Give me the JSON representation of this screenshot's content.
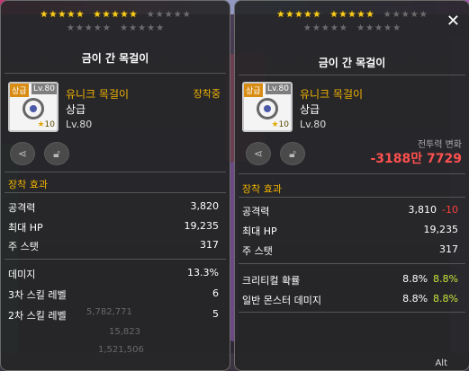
{
  "left": {
    "title": "금이 간 목걸이",
    "rank_tag": "상급",
    "level_tag": "Lv.80",
    "star_tag": "10",
    "item_name": "유니크 목걸이",
    "item_grade": "상급",
    "item_level": "Lv.80",
    "equipped": "장착중",
    "section": "장착 효과",
    "stats": [
      {
        "label": "공격력",
        "value": "3,820"
      },
      {
        "label": "최대 HP",
        "value": "19,235"
      },
      {
        "label": "주 스탯",
        "value": "317"
      },
      {
        "label": "데미지",
        "value": "13.3%"
      },
      {
        "label": "3차 스킬 레벨",
        "value": "6"
      },
      {
        "label": "2차 스킬 레벨",
        "value": "5"
      }
    ],
    "bg_numbers": [
      "5,782,771",
      "15,823",
      "1,521,506"
    ]
  },
  "right": {
    "title": "금이 간 목걸이",
    "rank_tag": "상급",
    "level_tag": "Lv.80",
    "star_tag": "10",
    "item_name": "유니크 목걸이",
    "item_grade": "상급",
    "item_level": "Lv.80",
    "power_label": "전투력 변화",
    "power_value": "-3188만 7729",
    "section": "장착 효과",
    "stats": [
      {
        "label": "공격력",
        "value": "3,810",
        "diff": "-10",
        "diff_type": "down"
      },
      {
        "label": "최대 HP",
        "value": "19,235",
        "diff": "",
        "diff_type": ""
      },
      {
        "label": "주 스탯",
        "value": "317",
        "diff": "",
        "diff_type": ""
      },
      {
        "label": "크리티컬 확률",
        "value": "8.8%",
        "diff": "8.8%",
        "diff_type": "up"
      },
      {
        "label": "일반 몬스터 데미지",
        "value": "8.8%",
        "diff": "8.8%",
        "diff_type": "up"
      }
    ],
    "close_icon": "close-icon",
    "alt_label": "Alt"
  },
  "stars": {
    "filled": 10,
    "total": 20
  },
  "colors": {
    "gold": "#f1b200",
    "red": "#ff4040",
    "green": "#c8e63a"
  }
}
